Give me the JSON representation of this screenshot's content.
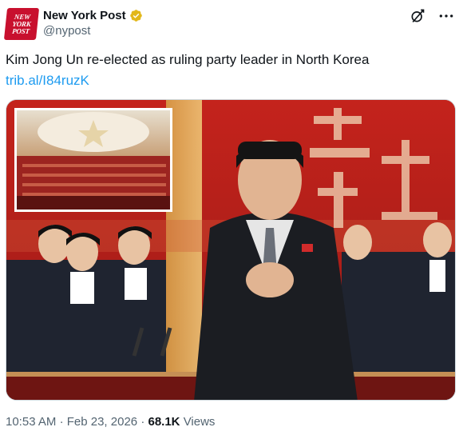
{
  "author": {
    "display_name": "New York Post",
    "handle": "@nypost",
    "avatar_lines": [
      "NEW",
      "YORK",
      "POST"
    ],
    "verified_badge_color": "#e2b719"
  },
  "tweet": {
    "text": "Kim Jong Un re-elected as ruling party leader in North Korea ",
    "link": "trib.al/I84ruzK"
  },
  "meta": {
    "time": "10:53 AM",
    "separator": "·",
    "date": "Feb 23, 2026",
    "views_count": "68.1K",
    "views_label": "Views"
  },
  "icons": {
    "grok": "grok-icon",
    "more": "more-options-icon",
    "verified": "verified-badge-icon"
  },
  "colors": {
    "brand_red": "#c8102e",
    "link_blue": "#1d9bf0",
    "muted": "#536471"
  }
}
